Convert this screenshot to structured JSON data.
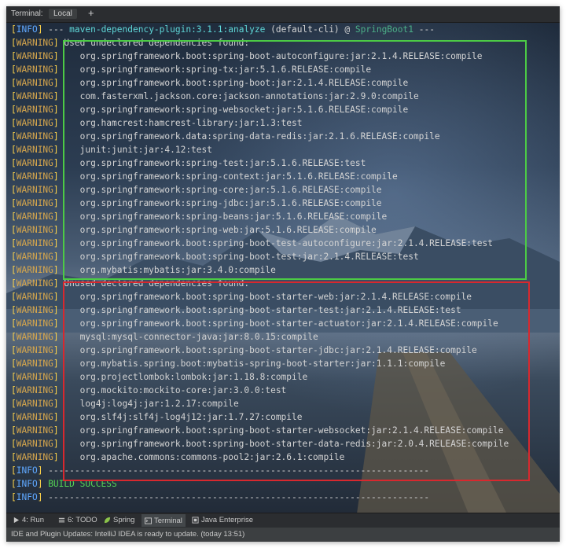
{
  "tabs": {
    "label": "Terminal:",
    "local": "Local",
    "add": "+"
  },
  "header": {
    "tag": "INFO",
    "dashes_left": "--- ",
    "plugin": "maven-dependency-plugin:3.1.1:analyze",
    "mid": " (default-cli) @ ",
    "project": "SpringBoot1",
    "dashes_right": " ---"
  },
  "warn_tag": "WARNING",
  "info_tag": "INFO",
  "undeclared": {
    "title": "Used undeclared dependencies found:",
    "items": [
      "   org.springframework.boot:spring-boot-autoconfigure:jar:2.1.4.RELEASE:compile",
      "   org.springframework:spring-tx:jar:5.1.6.RELEASE:compile",
      "   org.springframework.boot:spring-boot:jar:2.1.4.RELEASE:compile",
      "   com.fasterxml.jackson.core:jackson-annotations:jar:2.9.0:compile",
      "   org.springframework:spring-websocket:jar:5.1.6.RELEASE:compile",
      "   org.hamcrest:hamcrest-library:jar:1.3:test",
      "   org.springframework.data:spring-data-redis:jar:2.1.6.RELEASE:compile",
      "   junit:junit:jar:4.12:test",
      "   org.springframework:spring-test:jar:5.1.6.RELEASE:test",
      "   org.springframework:spring-context:jar:5.1.6.RELEASE:compile",
      "   org.springframework:spring-core:jar:5.1.6.RELEASE:compile",
      "   org.springframework:spring-jdbc:jar:5.1.6.RELEASE:compile",
      "   org.springframework:spring-beans:jar:5.1.6.RELEASE:compile",
      "   org.springframework:spring-web:jar:5.1.6.RELEASE:compile",
      "   org.springframework.boot:spring-boot-test-autoconfigure:jar:2.1.4.RELEASE:test",
      "   org.springframework.boot:spring-boot-test:jar:2.1.4.RELEASE:test",
      "   org.mybatis:mybatis:jar:3.4.0:compile"
    ]
  },
  "unused": {
    "title": "Unused declared dependencies found:",
    "items": [
      "   org.springframework.boot:spring-boot-starter-web:jar:2.1.4.RELEASE:compile",
      "   org.springframework.boot:spring-boot-starter-test:jar:2.1.4.RELEASE:test",
      "   org.springframework.boot:spring-boot-starter-actuator:jar:2.1.4.RELEASE:compile",
      "   mysql:mysql-connector-java:jar:8.0.15:compile",
      "   org.springframework.boot:spring-boot-starter-jdbc:jar:2.1.4.RELEASE:compile",
      "   org.mybatis.spring.boot:mybatis-spring-boot-starter:jar:1.1.1:compile",
      "   org.projectlombok:lombok:jar:1.18.8:compile",
      "   org.mockito:mockito-core:jar:3.0.0:test",
      "   log4j:log4j:jar:1.2.17:compile",
      "   org.slf4j:slf4j-log4j12:jar:1.7.27:compile",
      "   org.springframework.boot:spring-boot-starter-websocket:jar:2.1.4.RELEASE:compile",
      "   org.springframework.boot:spring-boot-starter-data-redis:jar:2.0.4.RELEASE:compile",
      "   org.apache.commons:commons-pool2:jar:2.6.1:compile"
    ]
  },
  "footer": {
    "separator": " ------------------------------------------------------------------------",
    "build": " BUILD SUCCESS"
  },
  "toolwindows": [
    {
      "label": "4: Run",
      "icon": "run-icon"
    },
    {
      "label": "6: TODO",
      "icon": "todo-icon"
    },
    {
      "label": "Spring",
      "icon": "spring-leaf-icon"
    },
    {
      "label": "Terminal",
      "icon": "terminal-icon"
    },
    {
      "label": "Java Enterprise",
      "icon": "java-enterprise-icon"
    }
  ],
  "status": "IDE and Plugin Updates: IntelliJ IDEA is ready to update. (today 13:51)"
}
